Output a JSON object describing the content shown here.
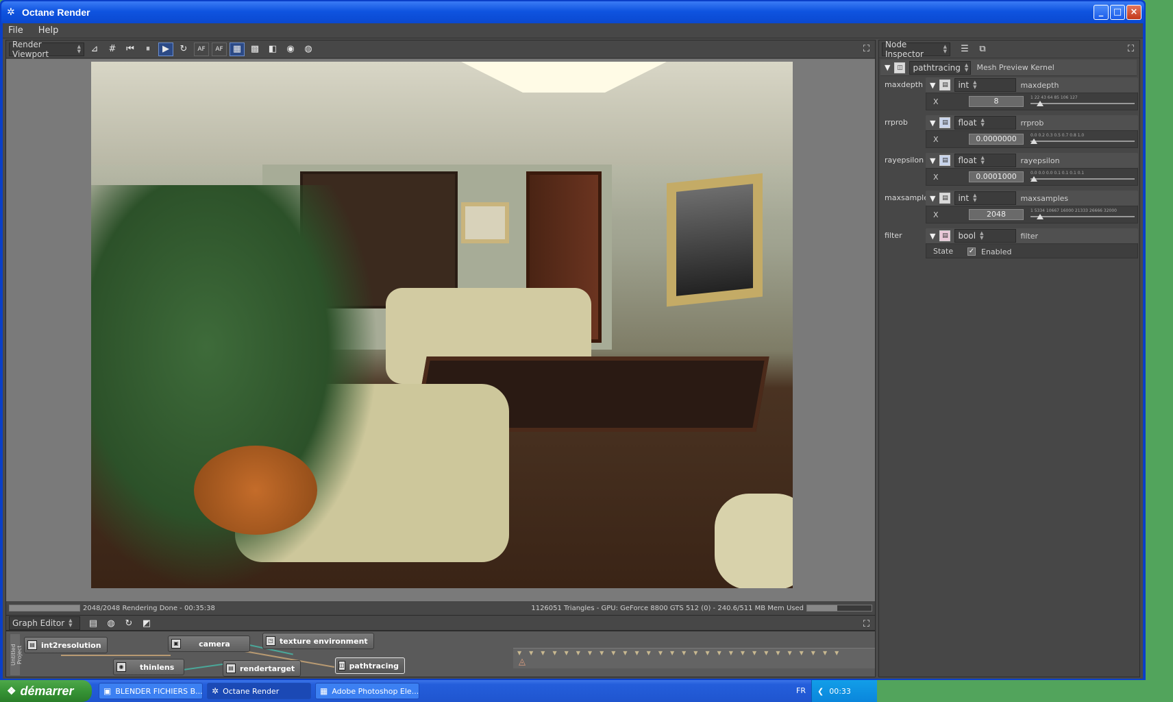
{
  "window": {
    "title": "Octane Render",
    "controls": [
      "_",
      "□",
      "×"
    ]
  },
  "menu": {
    "items": [
      "File",
      "Help"
    ]
  },
  "viewport": {
    "combo_label": "Render Viewport",
    "tools": [
      {
        "icon": "ruler-icon",
        "glyph": "⊿"
      },
      {
        "icon": "grid-icon",
        "glyph": "#"
      },
      {
        "icon": "skip-back-icon",
        "glyph": "⏮"
      },
      {
        "icon": "pause-icon",
        "glyph": "⏸"
      },
      {
        "icon": "play-icon",
        "glyph": "▶"
      },
      {
        "icon": "refresh-icon",
        "glyph": "↻"
      },
      {
        "icon": "autofocus-icon",
        "glyph": "AF"
      },
      {
        "icon": "autofocus-cursor-icon",
        "glyph": "AF"
      },
      {
        "icon": "region-icon",
        "glyph": "▦"
      },
      {
        "icon": "checker-icon",
        "glyph": "▩"
      },
      {
        "icon": "compare-icon",
        "glyph": "◧"
      },
      {
        "icon": "world-icon",
        "glyph": "◉"
      },
      {
        "icon": "world-lock-icon",
        "glyph": "◍"
      }
    ],
    "maximize_glyph": "⛶",
    "status_left": "2048/2048 Rendering Done - 00:35:38",
    "status_right": "1126051 Triangles - GPU: GeForce 8800 GTS 512 (0) - 240.6/511 MB Mem Used",
    "render_progress": 1.0,
    "mem_used_fraction": 0.47
  },
  "graph_editor": {
    "combo_label": "Graph Editor",
    "side_tab": "Untitled Project",
    "nodes": [
      {
        "label": "int2resolution",
        "icon": "▤"
      },
      {
        "label": "camera",
        "icon": "▣"
      },
      {
        "label": "texture environment",
        "icon": "◳"
      },
      {
        "label": "thinlens",
        "icon": "◉"
      },
      {
        "label": "rendertarget",
        "icon": "▤"
      },
      {
        "label": "pathtracing",
        "icon": "◫"
      }
    ],
    "timeline_ticks": "▼▼▼▼▼▼▼▼▼▼▼▼▼▼▼▼▼▼▼▼▼▼▼▼▼▼▼▼"
  },
  "inspector": {
    "combo_label": "Node Inspector",
    "kernel": {
      "type": "pathtracing",
      "name": "Mesh Preview Kernel"
    },
    "params": [
      {
        "label": "maxdepth",
        "type": "int",
        "name": "maxdepth",
        "axis": "X",
        "value": "8",
        "scale": "1   22   43   64   85   106  127",
        "fraction": 0.06
      },
      {
        "label": "rrprob",
        "type": "float",
        "name": "rrprob",
        "axis": "X",
        "value": "0.0000000",
        "scale": "0.0 0.2  0.3  0.5  0.7  0.8  1.0",
        "fraction": 0.0
      },
      {
        "label": "rayepsilon",
        "type": "float",
        "name": "rayepsilon",
        "axis": "X",
        "value": "0.0001000",
        "scale": "0.0 0.0  0.0  0.1  0.1  0.1  0.1",
        "fraction": 0.0
      },
      {
        "label": "maxsamples",
        "type": "int",
        "name": "maxsamples",
        "axis": "X",
        "value": "2048",
        "scale": "1 5334 10667 16000 21333 26666 32000",
        "fraction": 0.06
      }
    ],
    "filter": {
      "label": "filter",
      "type": "bool",
      "name": "filter",
      "state_label": "State",
      "checked_glyph": "✓",
      "enabled_label": "Enabled"
    }
  },
  "taskbar": {
    "start_label": "démarrer",
    "tasks": [
      {
        "label": "BLENDER FICHIERS B...",
        "icon": "▣"
      },
      {
        "label": "Octane Render",
        "icon": "✲"
      },
      {
        "label": "Adobe Photoshop Ele...",
        "icon": "▦"
      }
    ],
    "lang": "FR",
    "clock": "00:33"
  },
  "colors": {
    "titlebar": "#0f54e0",
    "panel_bg": "#474747",
    "desktop": "#52a45c",
    "active_tool": "#2c4a86"
  }
}
